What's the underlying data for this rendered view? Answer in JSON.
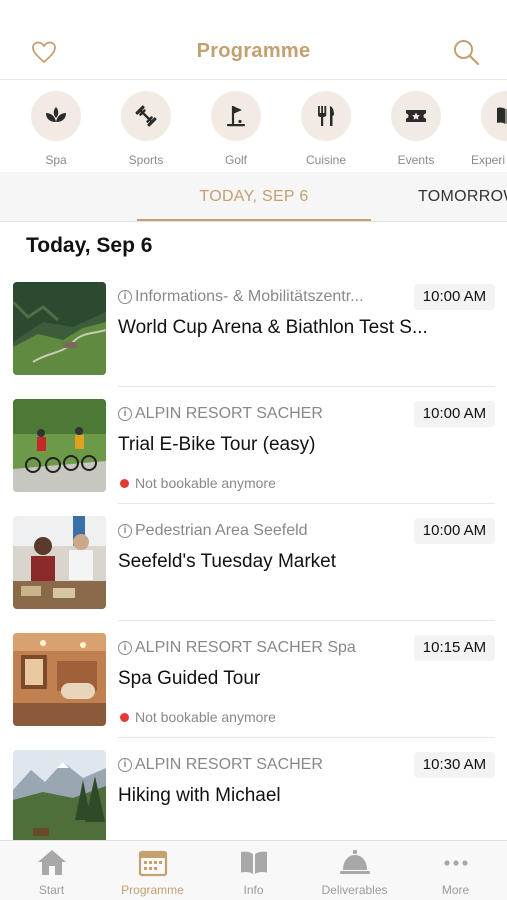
{
  "header": {
    "title": "Programme",
    "favorite_icon": "heart-icon",
    "search_icon": "search-icon"
  },
  "categories": [
    {
      "label": "Spa",
      "icon": "lotus-icon"
    },
    {
      "label": "Sports",
      "icon": "dumbbell-icon"
    },
    {
      "label": "Golf",
      "icon": "golf-flag-icon"
    },
    {
      "label": "Cuisine",
      "icon": "fork-knife-icon"
    },
    {
      "label": "Events",
      "icon": "ticket-icon"
    },
    {
      "label": "Experi",
      "icon": "book-icon"
    }
  ],
  "date_tabs": {
    "active": "TODAY, SEP 6",
    "next": "TOMORROW"
  },
  "day_title": "Today, Sep 6",
  "events": [
    {
      "location": "Informations- & Mobilitätszentr...",
      "time": "10:00 AM",
      "title": "World Cup Arena & Biathlon Test S...",
      "status": ""
    },
    {
      "location": "ALPIN RESORT SACHER",
      "time": "10:00 AM",
      "title": "Trial E-Bike Tour (easy)",
      "status": "Not bookable anymore"
    },
    {
      "location": "Pedestrian Area Seefeld",
      "time": "10:00 AM",
      "title": "Seefeld's Tuesday Market",
      "status": ""
    },
    {
      "location": "ALPIN RESORT SACHER Spa",
      "time": "10:15 AM",
      "title": "Spa Guided Tour",
      "status": "Not bookable anymore"
    },
    {
      "location": "ALPIN RESORT SACHER",
      "time": "10:30 AM",
      "title": "Hiking with Michael",
      "status": ""
    }
  ],
  "info_glyph": "i",
  "tabbar": [
    {
      "label": "Start",
      "icon": "house-icon"
    },
    {
      "label": "Programme",
      "icon": "calendar-icon"
    },
    {
      "label": "Info",
      "icon": "open-book-icon"
    },
    {
      "label": "Deliverables",
      "icon": "service-bell-icon"
    },
    {
      "label": "More",
      "icon": "more-dots-icon"
    }
  ],
  "colors": {
    "accent": "#c3a070",
    "category_bg": "#f2ebe3",
    "unavailable_dot": "#e53935",
    "icon_dark": "#2b2b2b"
  }
}
